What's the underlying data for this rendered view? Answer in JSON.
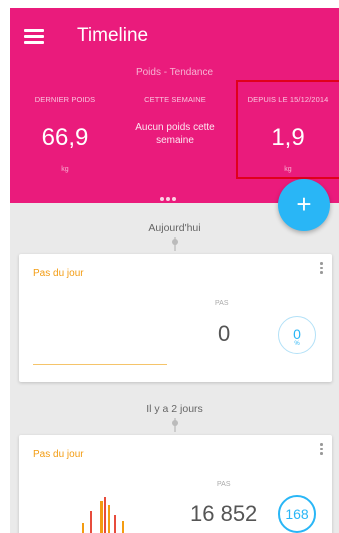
{
  "header": {
    "title": "Timeline",
    "subtitle": "Poids - Tendance",
    "columns": [
      {
        "label": "DERNIER POIDS",
        "value": "66,9",
        "unit": "kg"
      },
      {
        "label": "CETTE SEMAINE",
        "note": "Aucun poids cette semaine"
      },
      {
        "label": "DEPUIS LE 15/12/2014",
        "value": "1,9",
        "unit": "kg"
      }
    ]
  },
  "fab": {
    "label": "+"
  },
  "timeline": [
    {
      "day_label": "Aujourd'hui",
      "card": {
        "title": "Pas du jour",
        "steps_label": "PAS",
        "steps": "0",
        "goal_value": "0",
        "goal_unit": "%"
      }
    },
    {
      "day_label": "Il y a 2 jours",
      "card": {
        "title": "Pas du jour",
        "steps_label": "PAS",
        "steps": "16 852",
        "goal_value": "168",
        "goal_unit": "%"
      }
    }
  ],
  "colors": {
    "header": "#ea1b7c",
    "accent": "#29b6f6",
    "card_title": "#f39c12",
    "highlight": "#e0001b"
  },
  "icons": {
    "menu": "hamburger-menu-icon",
    "add": "plus-icon",
    "more": "kebab-menu-icon"
  }
}
